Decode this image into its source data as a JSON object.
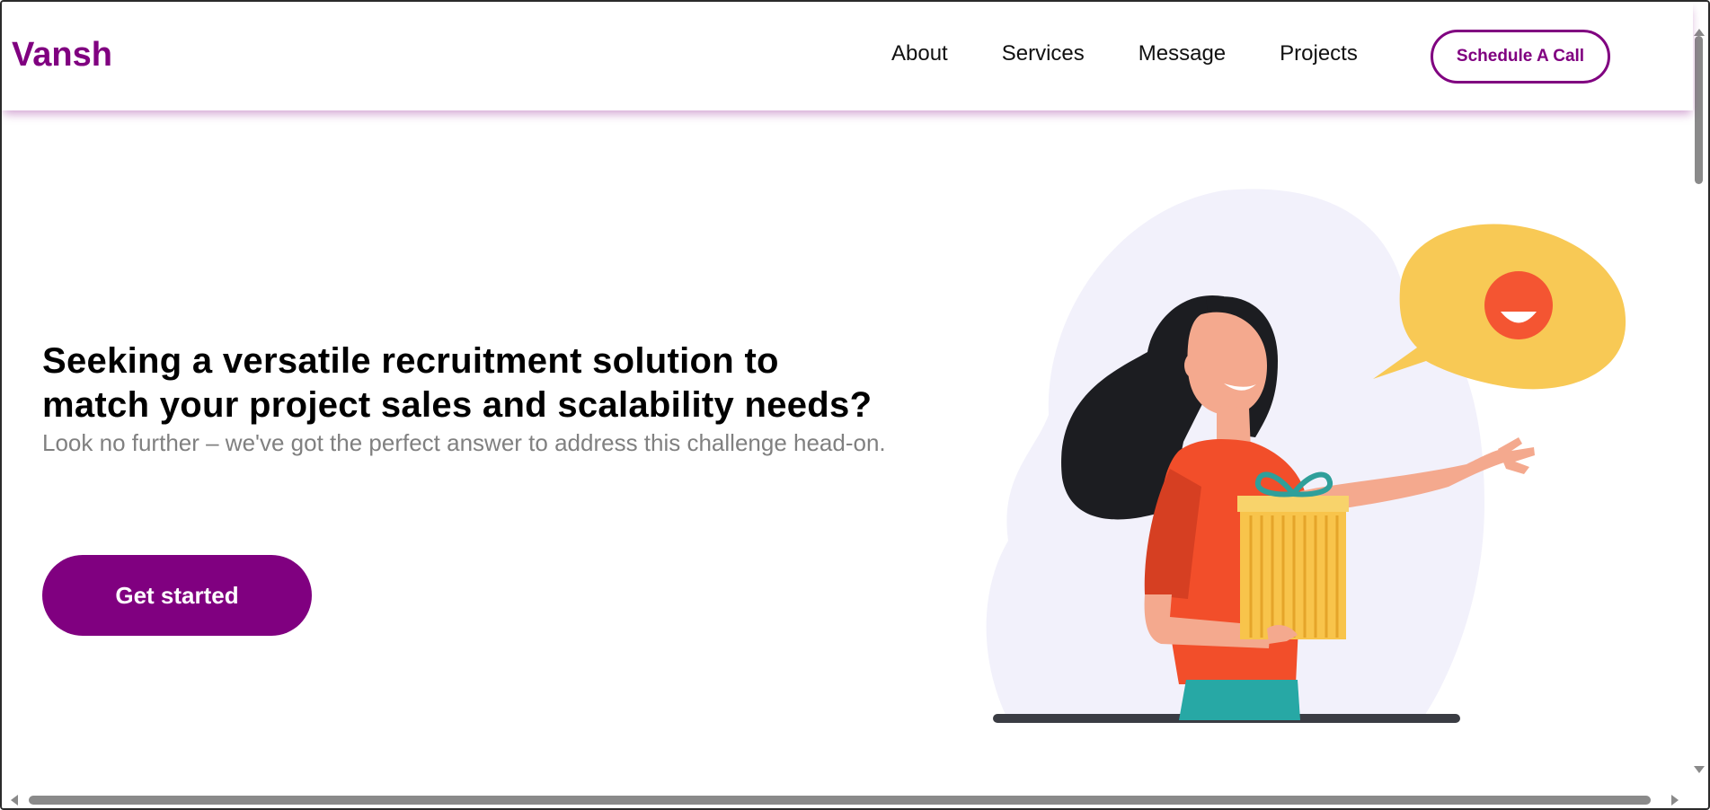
{
  "header": {
    "brand": "Vansh",
    "nav": [
      {
        "label": "About"
      },
      {
        "label": "Services"
      },
      {
        "label": "Message"
      },
      {
        "label": "Projects"
      }
    ],
    "cta_label": "Schedule A Call"
  },
  "hero": {
    "title_line1": "Seeking a versatile recruitment solution to",
    "title_line2": "match your project sales and scalability needs?",
    "subtitle": "Look no further – we've got the perfect answer to address this challenge head-on.",
    "button_label": "Get started"
  },
  "illustration": {
    "icon": "woman-with-gift-illustration"
  },
  "colors": {
    "brand": "#800080",
    "text": "#000000",
    "muted": "#808080"
  }
}
